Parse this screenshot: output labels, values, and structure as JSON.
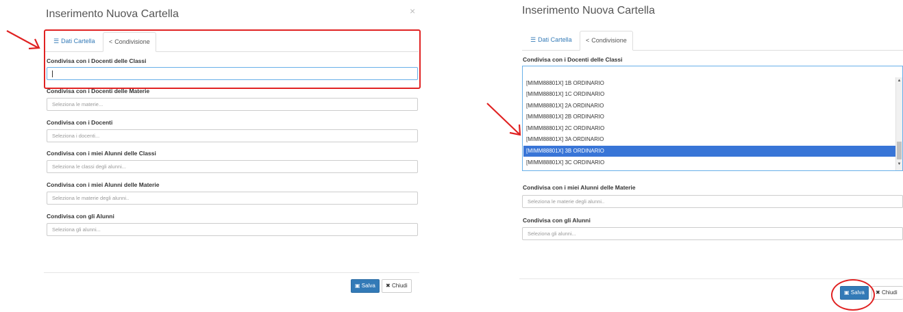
{
  "left_panel": {
    "title": "Inserimento Nuova Cartella",
    "close_glyph": "×",
    "tabs": [
      {
        "label": "Dati Cartella",
        "icon": "list-icon"
      },
      {
        "label": "Condivisione",
        "icon": "share-icon"
      }
    ],
    "fields": [
      {
        "label": "Condivisa con i Docenti delle Classi",
        "placeholder": ""
      },
      {
        "label": "Condivisa con i Docenti delle Materie",
        "placeholder": "Seleziona le materie..."
      },
      {
        "label": "Condivisa con i Docenti",
        "placeholder": "Seleziona i docenti..."
      },
      {
        "label": "Condivisa con i miei Alunni delle Classi",
        "placeholder": "Seleziona le classi degli alunni..."
      },
      {
        "label": "Condivisa con i miei Alunni delle Materie",
        "placeholder": "Seleziona le materie degli alunni.."
      },
      {
        "label": "Condivisa con gli Alunni",
        "placeholder": "Seleziona gli alunni..."
      }
    ],
    "buttons": {
      "save": "Salva",
      "close": "Chiudi"
    }
  },
  "right_panel": {
    "title": "Inserimento Nuova Cartella",
    "tabs": [
      {
        "label": "Dati Cartella",
        "icon": "list-icon"
      },
      {
        "label": "Condivisione",
        "icon": "share-icon"
      }
    ],
    "fields": [
      {
        "label": "Condivisa con i Docenti delle Classi",
        "placeholder": ""
      },
      {
        "label": "Condivisa con i miei Alunni delle Materie",
        "placeholder": "Seleziona le materie degli alunni.."
      },
      {
        "label": "Condivisa con gli Alunni",
        "placeholder": "Seleziona gli alunni..."
      }
    ],
    "dropdown_options": [
      "[MIMM88801X] 1B ORDINARIO",
      "[MIMM88801X] 1C ORDINARIO",
      "[MIMM88801X] 2A ORDINARIO",
      "[MIMM88801X] 2B ORDINARIO",
      "[MIMM88801X] 2C ORDINARIO",
      "[MIMM88801X] 3A ORDINARIO",
      "[MIMM88801X] 3B ORDINARIO",
      "[MIMM88801X] 3C ORDINARIO"
    ],
    "selected_option": "[MIMM88801X] 3B ORDINARIO",
    "buttons": {
      "save": "Salva",
      "close": "Chiudi"
    }
  },
  "colors": {
    "annotation_red": "#e02222",
    "primary_blue": "#337ab7",
    "selected_blue": "#3875d7"
  }
}
